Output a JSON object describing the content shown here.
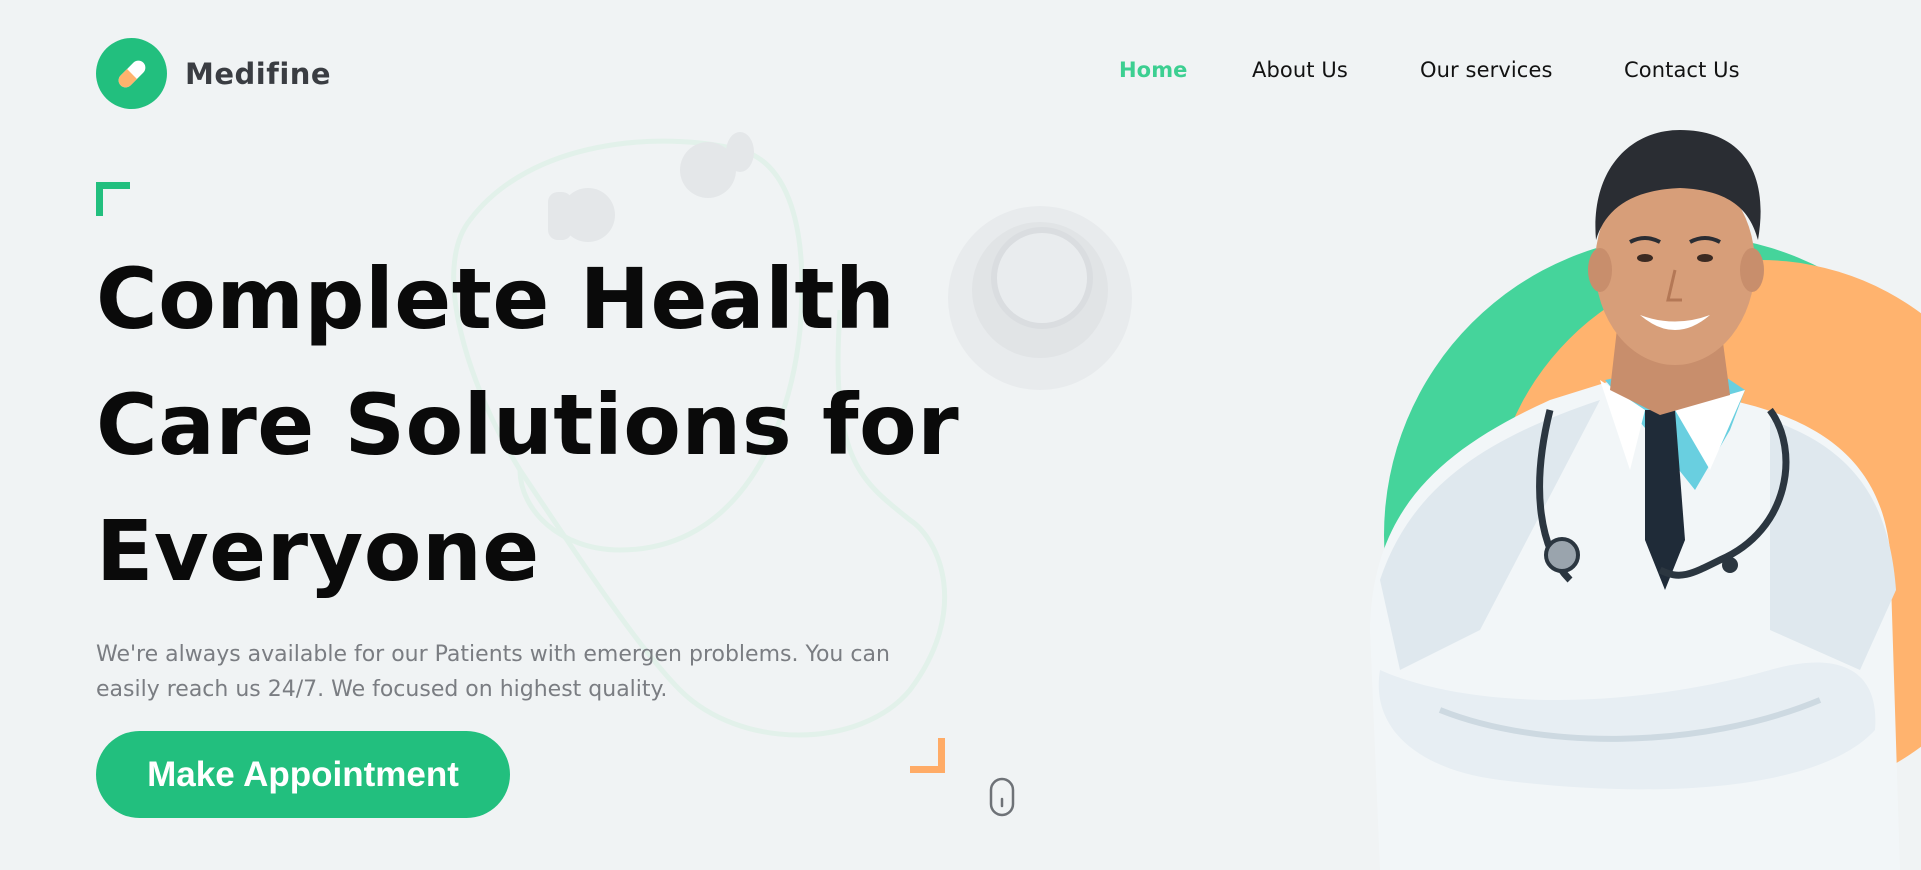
{
  "brand": {
    "name": "Medifine",
    "logo_icon": "pill-icon"
  },
  "nav": {
    "items": [
      {
        "label": "Home",
        "active": true
      },
      {
        "label": "About Us",
        "active": false
      },
      {
        "label": "Our services",
        "active": false
      },
      {
        "label": "Contact Us",
        "active": false
      }
    ]
  },
  "hero": {
    "headline_lines": [
      "Complete Health",
      "Care Solutions for",
      "Everyone"
    ],
    "description_lines": [
      "We're always available for our Patients with emergen problems. You can",
      "easily reach us 24/7. We focused on highest quality."
    ],
    "cta_label": "Make Appointment",
    "scroll_icon": "mouse-scroll-icon",
    "illustration": "doctor-portrait",
    "decoration_icon": "stethoscope-icon"
  },
  "colors": {
    "primary": "#22bf7e",
    "primary_light": "#45d49b",
    "accent": "#ffab66",
    "nav_active": "#3ccf91",
    "background": "#f0f3f4",
    "heading": "#0a0a0a",
    "body_text": "#7a7d82"
  }
}
